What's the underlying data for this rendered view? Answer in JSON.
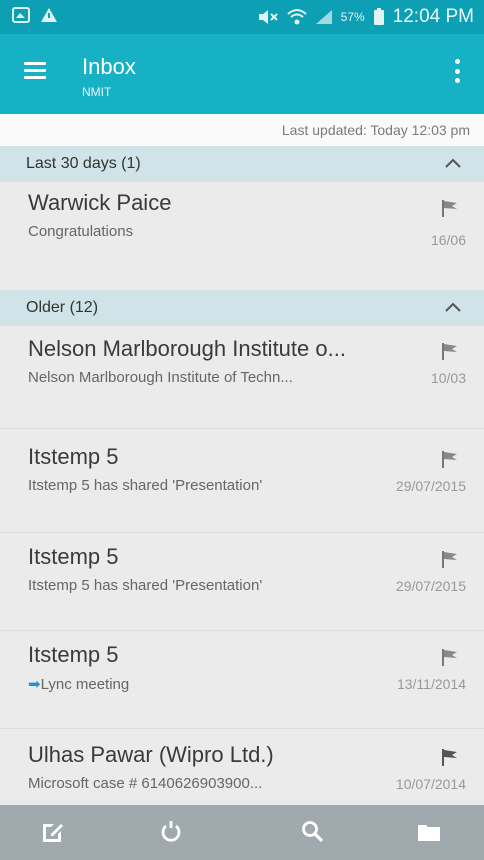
{
  "status_bar": {
    "battery": "57%",
    "time": "12:04 PM"
  },
  "app_bar": {
    "title": "Inbox",
    "subtitle": "NMIT"
  },
  "last_updated": "Last updated: Today 12:03 pm",
  "sections": [
    {
      "label": "Last 30 days (1)",
      "items": [
        {
          "sender": "Warwick Paice",
          "subject": "Congratulations",
          "date": "16/06",
          "has_arrow": false
        }
      ]
    },
    {
      "label": "Older (12)",
      "items": [
        {
          "sender": "Nelson Marlborough Institute o...",
          "subject": "Nelson Marlborough Institute of Techn...",
          "date": "10/03",
          "has_arrow": false
        },
        {
          "sender": "Itstemp 5",
          "subject": "Itstemp 5 has shared 'Presentation'",
          "date": "29/07/2015",
          "has_arrow": false
        },
        {
          "sender": "Itstemp 5",
          "subject": "Itstemp 5 has shared 'Presentation'",
          "date": "29/07/2015",
          "has_arrow": false
        },
        {
          "sender": "Itstemp 5",
          "subject": "Lync meeting",
          "date": "13/11/2014",
          "has_arrow": true
        },
        {
          "sender": "Ulhas Pawar (Wipro Ltd.)",
          "subject": "Microsoft case # 6140626903900...",
          "date": "10/07/2014",
          "has_arrow": false
        }
      ]
    }
  ],
  "bottom_bar": {
    "icons": [
      "compose-icon",
      "refresh-icon",
      "search-icon",
      "folder-icon"
    ]
  },
  "colors": {
    "status_bar": "#0d9fb3",
    "app_bar": "#17b1c6",
    "section_header": "#cfe3e8",
    "list_bg": "#ebebeb",
    "bottom_bar": "#9fa9ae"
  }
}
